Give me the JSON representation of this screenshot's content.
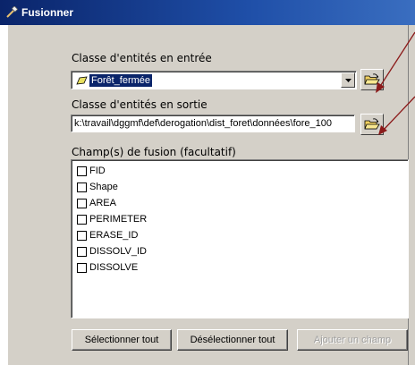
{
  "window": {
    "title": "Fusionner"
  },
  "input": {
    "label": "Classe d'entités en entrée",
    "value": "Forêt_fermée",
    "value_icon": "polygon-layer-icon"
  },
  "output": {
    "label": "Classe d'entités en sortie",
    "value": "k:\\travail\\dggmf\\def\\derogation\\dist_foret\\données\\fore_100"
  },
  "fields": {
    "label": "Champ(s) de fusion (facultatif)",
    "items": [
      {
        "label": "FID",
        "checked": false
      },
      {
        "label": "Shape",
        "checked": false
      },
      {
        "label": "AREA",
        "checked": false
      },
      {
        "label": "PERIMETER",
        "checked": false
      },
      {
        "label": "ERASE_ID",
        "checked": false
      },
      {
        "label": "DISSOLV_ID",
        "checked": false
      },
      {
        "label": "DISSOLVE",
        "checked": false
      }
    ]
  },
  "buttons": {
    "select_all": "Sélectionner tout",
    "deselect_all": "Désélectionner tout",
    "add_field": "Ajouter un champ"
  },
  "icons": {
    "title": "hammer-icon",
    "browse": "open-folder-icon",
    "dropdown": "chevron-down-icon",
    "annotation": "red-arrow-icon"
  },
  "colors": {
    "titlebar": "#0a246a",
    "selection": "#0a246a",
    "annotation_arrow": "#8b1a1a",
    "dialog_bg": "#d4d0c8"
  }
}
